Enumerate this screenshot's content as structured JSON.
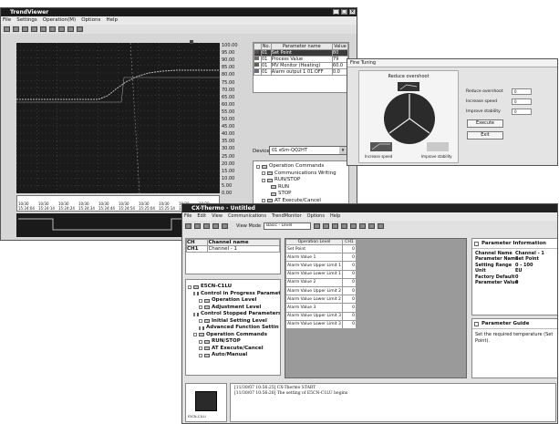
{
  "trendviewer": {
    "title": "TrendViewer",
    "menu": [
      "File",
      "Settings",
      "Operation(M)",
      "Options",
      "Help"
    ],
    "yaxis": [
      "100.00",
      "95.00",
      "90.00",
      "85.00",
      "80.00",
      "75.00",
      "70.00",
      "65.00",
      "60.00",
      "55.00",
      "50.00",
      "45.00",
      "40.00",
      "35.00",
      "30.00",
      "25.00",
      "20.00",
      "15.00",
      "10.00",
      "5.00",
      "0.00"
    ],
    "time_labels": [
      {
        "d": "10/30",
        "t": "15:24:04"
      },
      {
        "d": "10/30",
        "t": "15:24:14"
      },
      {
        "d": "10/30",
        "t": "15:24:24"
      },
      {
        "d": "10/30",
        "t": "15:24:34"
      },
      {
        "d": "10/30",
        "t": "15:24:44"
      },
      {
        "d": "10/30",
        "t": "15:24:54"
      },
      {
        "d": "10/30",
        "t": "15:25:04"
      },
      {
        "d": "10/30",
        "t": "15:25:14"
      },
      {
        "d": "10/30",
        "t": "15:25:24"
      },
      {
        "d": "10/30",
        "t": "15:25:34"
      }
    ],
    "param_table": {
      "headers": [
        "No.",
        "Parameter name",
        "Value"
      ],
      "rows": [
        {
          "no": "01",
          "name": "Set Point",
          "value": "80",
          "color": "#555555",
          "selected": true
        },
        {
          "no": "01",
          "name": "Process Value",
          "value": "79",
          "color": "#7a6a6a",
          "selected": false
        },
        {
          "no": "01",
          "name": "MV Monitor (Heating)",
          "value": "60.0",
          "color": "#6b5a5a",
          "selected": false
        },
        {
          "no": "01",
          "name": "Alarm output 1 01:OFF",
          "value": "0.0",
          "color": "#6a6a7a",
          "selected": false
        }
      ]
    },
    "device_label": "Device:",
    "device_value": "01 eSm-QQ2HT",
    "ops_tree": [
      "Operation Commands",
      "Communications Writing",
      "RUN/STOP",
      "RUN",
      "STOP",
      "AT Execute/Cancel"
    ]
  },
  "pidtuning": {
    "title": "Fine Tuning",
    "header": "Reduce overshoot",
    "rows": [
      {
        "label": "Reduce overshoot",
        "value": "0"
      },
      {
        "label": "Increase speed",
        "value": "0"
      },
      {
        "label": "Improve stability",
        "value": "0"
      }
    ],
    "execute": "Execute",
    "exit": "Exit",
    "caption_left": "Increase speed",
    "caption_right": "Improve stability"
  },
  "cxthermo": {
    "title": "CX-Thermo - Untitled",
    "menu": [
      "File",
      "Edit",
      "View",
      "Communications",
      "TrendMonitor",
      "Options",
      "Help"
    ],
    "view_mode_label": "View Mode",
    "view_mode_value": "Basic - Level",
    "channel_headers": [
      "CH",
      "Channel name"
    ],
    "channel_row": {
      "ch": "CH1",
      "name": "Channel - 1"
    },
    "tree": [
      {
        "label": "E5CN-C1LU",
        "level": 0,
        "bold": true
      },
      {
        "label": "Control in Progress Paramet",
        "level": 1,
        "bold": true
      },
      {
        "label": "Operation Level",
        "level": 2,
        "bold": true
      },
      {
        "label": "Adjustment Level",
        "level": 2,
        "bold": true
      },
      {
        "label": "Control Stopped Parameters",
        "level": 1,
        "bold": true
      },
      {
        "label": "Initial Setting Level",
        "level": 2,
        "bold": true
      },
      {
        "label": "Advanced Function Settin",
        "level": 2,
        "bold": true
      },
      {
        "label": "Operation Commands",
        "level": 1,
        "bold": true
      },
      {
        "label": "RUN/STOP",
        "level": 2,
        "bold": true
      },
      {
        "label": "AT Execute/Cancel",
        "level": 2,
        "bold": true
      },
      {
        "label": "Auto/Manual",
        "level": 2,
        "bold": true
      }
    ],
    "grid_headers": [
      "Operation Level",
      "CH1"
    ],
    "grid_rows": [
      {
        "name": "Set Point",
        "value": "0"
      },
      {
        "name": "Alarm Value 1",
        "value": "0"
      },
      {
        "name": "Alarm Value Upper Limit 1",
        "value": "0"
      },
      {
        "name": "Alarm Value Lower Limit 1",
        "value": "0"
      },
      {
        "name": "Alarm Value 2",
        "value": "0"
      },
      {
        "name": "Alarm Value Upper Limit 2",
        "value": "0"
      },
      {
        "name": "Alarm Value Lower Limit 2",
        "value": "0"
      },
      {
        "name": "Alarm Value 3",
        "value": "0"
      },
      {
        "name": "Alarm Value Upper Limit 3",
        "value": "0"
      },
      {
        "name": "Alarm Value Lower Limit 3",
        "value": "0"
      }
    ],
    "param_info_title": "Parameter Information",
    "param_info": [
      {
        "k": "Channel Name",
        "v": "Channel - 1"
      },
      {
        "k": "Parameter Name",
        "v": "Set Point"
      },
      {
        "k": "Setting Range",
        "v": "0 - 100"
      },
      {
        "k": "Unit",
        "v": "EU"
      },
      {
        "k": "Factory Default",
        "v": "0"
      },
      {
        "k": "Parameter Value",
        "v": "0"
      }
    ],
    "param_guide_title": "Parameter Guide",
    "param_guide_text": "Set the required temperature (Set Point).",
    "log": [
      "[11/30/07 10:56:25] CX-Thermo START",
      "[11/30/07 10:56:26] The setting of E5CN-C1LU begins"
    ],
    "device_caption": "E5CN-C1LU"
  }
}
